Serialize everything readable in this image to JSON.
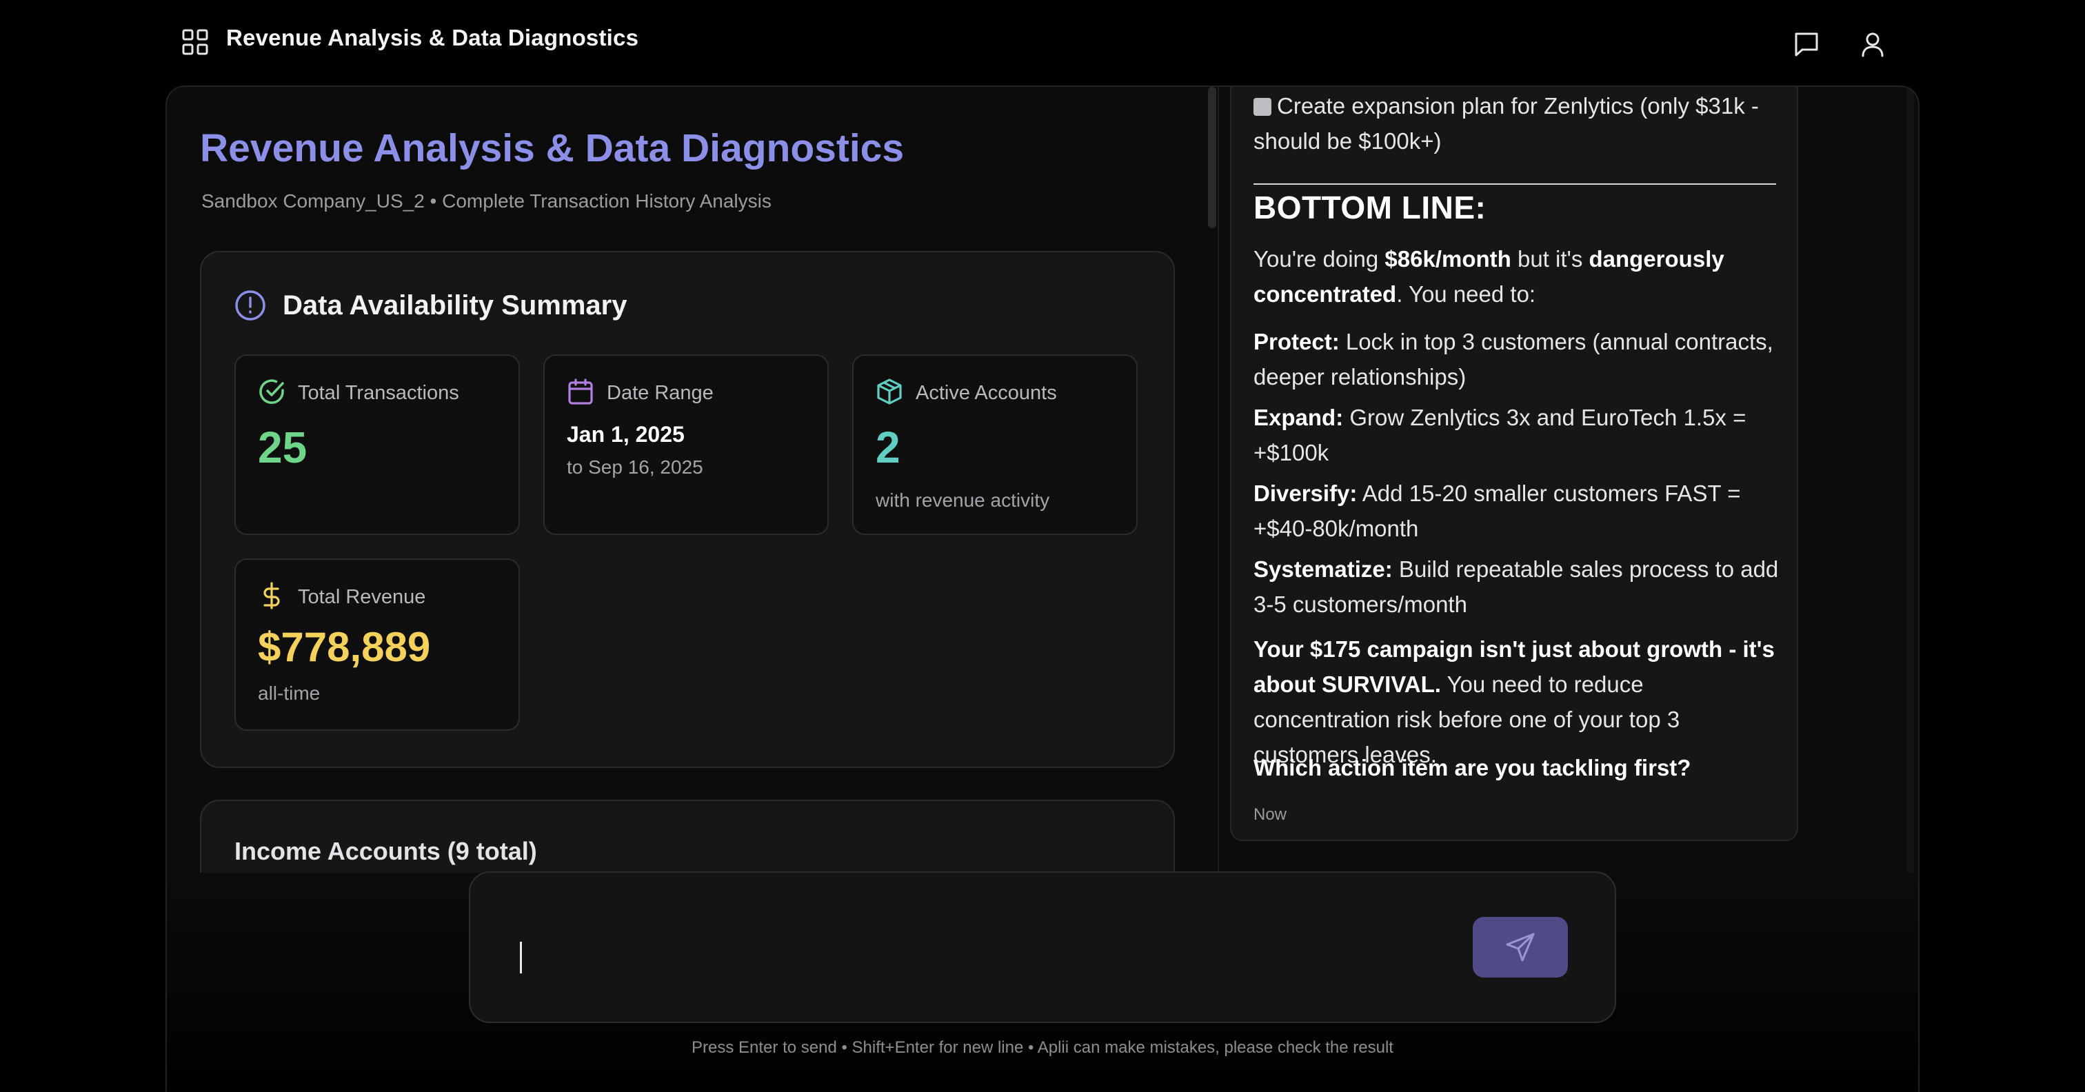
{
  "header": {
    "app_title": "Revenue Analysis & Data Diagnostics",
    "icons": [
      "grid-icon",
      "chat-icon",
      "user-icon"
    ]
  },
  "report": {
    "title": "Revenue Analysis & Data Diagnostics",
    "subtitle": "Sandbox Company_US_2 • Complete Transaction History Analysis",
    "summary": {
      "title": "Data Availability Summary",
      "stats": {
        "transactions": {
          "label": "Total Transactions",
          "value": "25"
        },
        "date_range": {
          "label": "Date Range",
          "value": "Jan 1, 2025",
          "sub": "to Sep 16, 2025"
        },
        "accounts": {
          "label": "Active Accounts",
          "value": "2",
          "sub": "with revenue activity"
        },
        "revenue": {
          "label": "Total Revenue",
          "value": "$778,889",
          "sub": "all-time"
        }
      }
    },
    "income": {
      "title": "Income Accounts (9 total)"
    }
  },
  "chat": {
    "checklist_item": "Create expansion plan for Zenlytics (only $31k - should be $100k+)",
    "bottom_line_heading": "BOTTOM LINE:",
    "intro": {
      "pre": "You're doing ",
      "bold1": "$86k/month",
      "mid": " but it's ",
      "bold2": "dangerously concentrated",
      "post": ". You need to:"
    },
    "actions": [
      {
        "term": "Protect:",
        "text": " Lock in top 3 customers (annual contracts, deeper relationships)"
      },
      {
        "term": "Expand:",
        "text": " Grow Zenlytics 3x and EuroTech 1.5x = +$100k"
      },
      {
        "term": "Diversify:",
        "text": " Add 15-20 smaller customers FAST = +$40-80k/month"
      },
      {
        "term": "Systematize:",
        "text": " Build repeatable sales process to add 3-5 customers/month"
      }
    ],
    "survival": {
      "bold": "Your $175 campaign isn't just about growth - it's about SURVIVAL.",
      "text": " You need to reduce concentration risk before one of your top 3 customers leaves."
    },
    "question": "Which action item are you tackling first?",
    "timestamp": "Now"
  },
  "composer": {
    "placeholder": "",
    "hint": "Press Enter to send • Shift+Enter for new line • Aplii can make mistakes, please check the result"
  },
  "colors": {
    "accent_title": "#8b8fe8",
    "green": "#6fd58a",
    "teal": "#5ecfc0",
    "yellow": "#f3d15a",
    "purple_icon": "#b07fe0",
    "send_button": "#4f4b86"
  }
}
